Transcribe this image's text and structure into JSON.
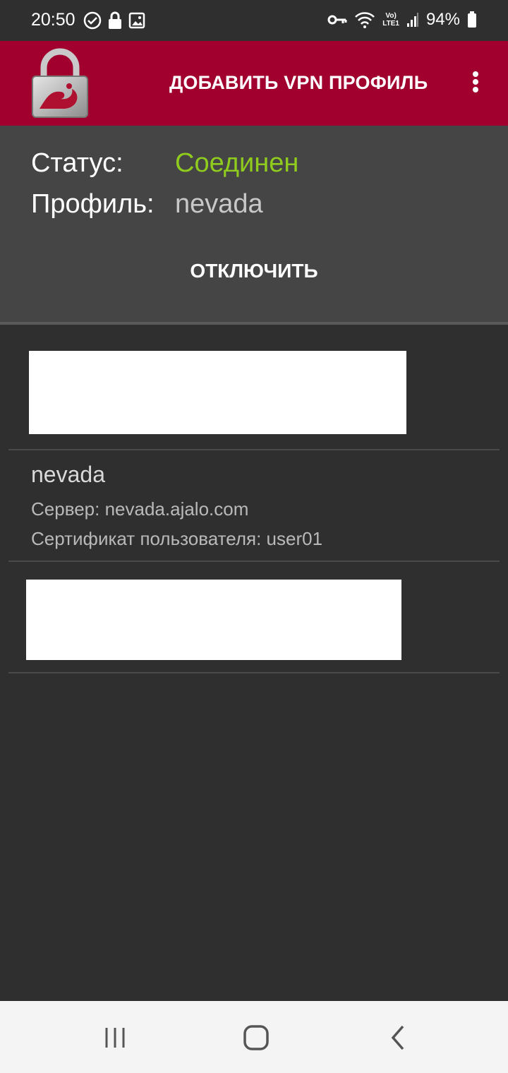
{
  "statusbar": {
    "time": "20:50",
    "battery": "94%",
    "icons_left": [
      "check-circle-icon",
      "lock-icon",
      "image-icon"
    ],
    "icons_right": [
      "vpn-key-icon",
      "wifi-icon",
      "volte-lte-icon",
      "signal-icon",
      "battery-icon"
    ],
    "volte_text": "Vo)",
    "lte_text": "LTE1"
  },
  "appbar": {
    "logo": "strongswan-lock-logo",
    "add_profile_label": "ДОБАВИТЬ VPN ПРОФИЛЬ",
    "overflow": "more-vert-icon",
    "background": "#a1002e"
  },
  "status_panel": {
    "status_label": "Статус:",
    "status_value": "Соединен",
    "profile_label": "Профиль:",
    "profile_value": "nevada",
    "disconnect_label": "ОТКЛЮЧИТЬ",
    "connected_color": "#8fcc1e"
  },
  "profiles": [
    {
      "name": "",
      "redacted": true
    },
    {
      "name": "nevada",
      "server": "Сервер: nevada.ajalo.com",
      "cert": "Сертификат пользователя: user01",
      "redacted": false
    },
    {
      "name": "",
      "redacted": true
    }
  ],
  "navbar": {
    "buttons": [
      "recents-icon",
      "home-icon",
      "back-icon"
    ]
  }
}
